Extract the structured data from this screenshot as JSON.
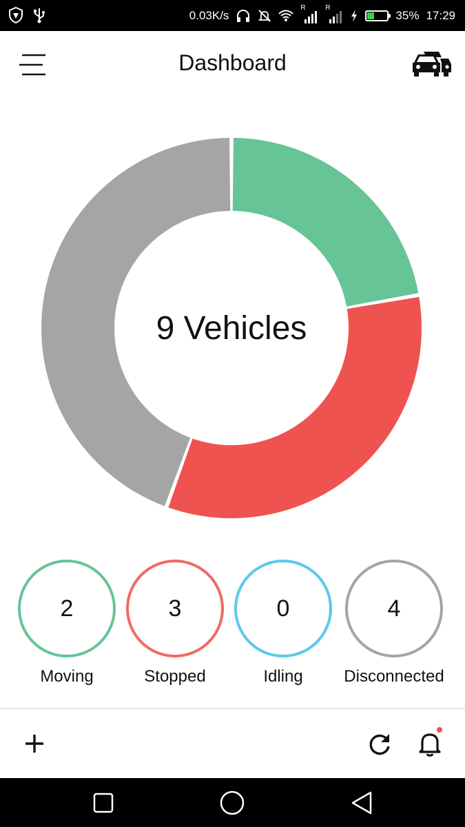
{
  "status_bar": {
    "net_speed": "0.03K/s",
    "battery_percent": "35%",
    "battery_level": 0.35,
    "time": "17:29",
    "signal_tag_1": "R",
    "signal_tag_2": "R",
    "icons": [
      "shield-icon",
      "usb-icon",
      "headphones-icon",
      "mute-bell-icon",
      "wifi-icon",
      "signal-icon",
      "signal-icon",
      "charging-icon",
      "battery-icon"
    ]
  },
  "app_bar": {
    "title": "Dashboard",
    "menu_icon": "hamburger-menu-icon",
    "right_icon": "car-icon"
  },
  "donut": {
    "center_text": "9 Vehicles"
  },
  "chart_data": {
    "type": "pie",
    "categories": [
      "Moving",
      "Stopped",
      "Idling",
      "Disconnected"
    ],
    "values": [
      2,
      3,
      0,
      4
    ],
    "colors": [
      "#66c497",
      "#ef5350",
      "#4fc3e8",
      "#a5a5a5"
    ],
    "total": 9
  },
  "stats": [
    {
      "label": "Moving",
      "value": "2",
      "color": "#66c497"
    },
    {
      "label": "Stopped",
      "value": "3",
      "color": "#ef6b62"
    },
    {
      "label": "Idling",
      "value": "0",
      "color": "#5bc8ea"
    },
    {
      "label": "Disconnected",
      "value": "4",
      "color": "#a5a5a5"
    }
  ],
  "bottom_bar": {
    "add_icon": "plus-icon",
    "refresh_icon": "refresh-icon",
    "notifications_icon": "bell-icon"
  },
  "nav_bar": {
    "icons": [
      "recent-apps-icon",
      "home-icon",
      "back-icon"
    ]
  }
}
